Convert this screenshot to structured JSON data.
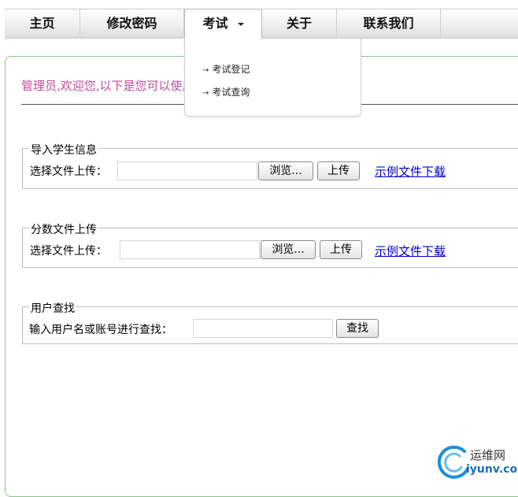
{
  "nav": {
    "items": [
      {
        "label": "主页"
      },
      {
        "label": "修改密码"
      },
      {
        "label": "考试"
      },
      {
        "label": "关于"
      },
      {
        "label": "联系我们"
      }
    ],
    "dropdown": [
      {
        "label": "考试登记"
      },
      {
        "label": "考试查询"
      }
    ]
  },
  "welcome": "管理员,欢迎您,以下是您可以使用的功能",
  "sections": [
    {
      "legend": "导入学生信息",
      "label": "选择文件上传：",
      "browse": "浏览...",
      "upload": "上传",
      "link": "示例文件下载"
    },
    {
      "legend": "分数文件上传",
      "label": "选择文件上传：",
      "browse": "浏览...",
      "upload": "上传",
      "link": "示例文件下载"
    },
    {
      "legend": "用户查找",
      "label": "输入用户名或账号进行查找：",
      "search": "查找"
    }
  ],
  "watermark": {
    "top": "运维网",
    "bottom": "iyunv.com"
  },
  "colors": {
    "welcome": "#c04a9a",
    "link": "#0000cc",
    "panel_border": "#8fbf8f"
  }
}
